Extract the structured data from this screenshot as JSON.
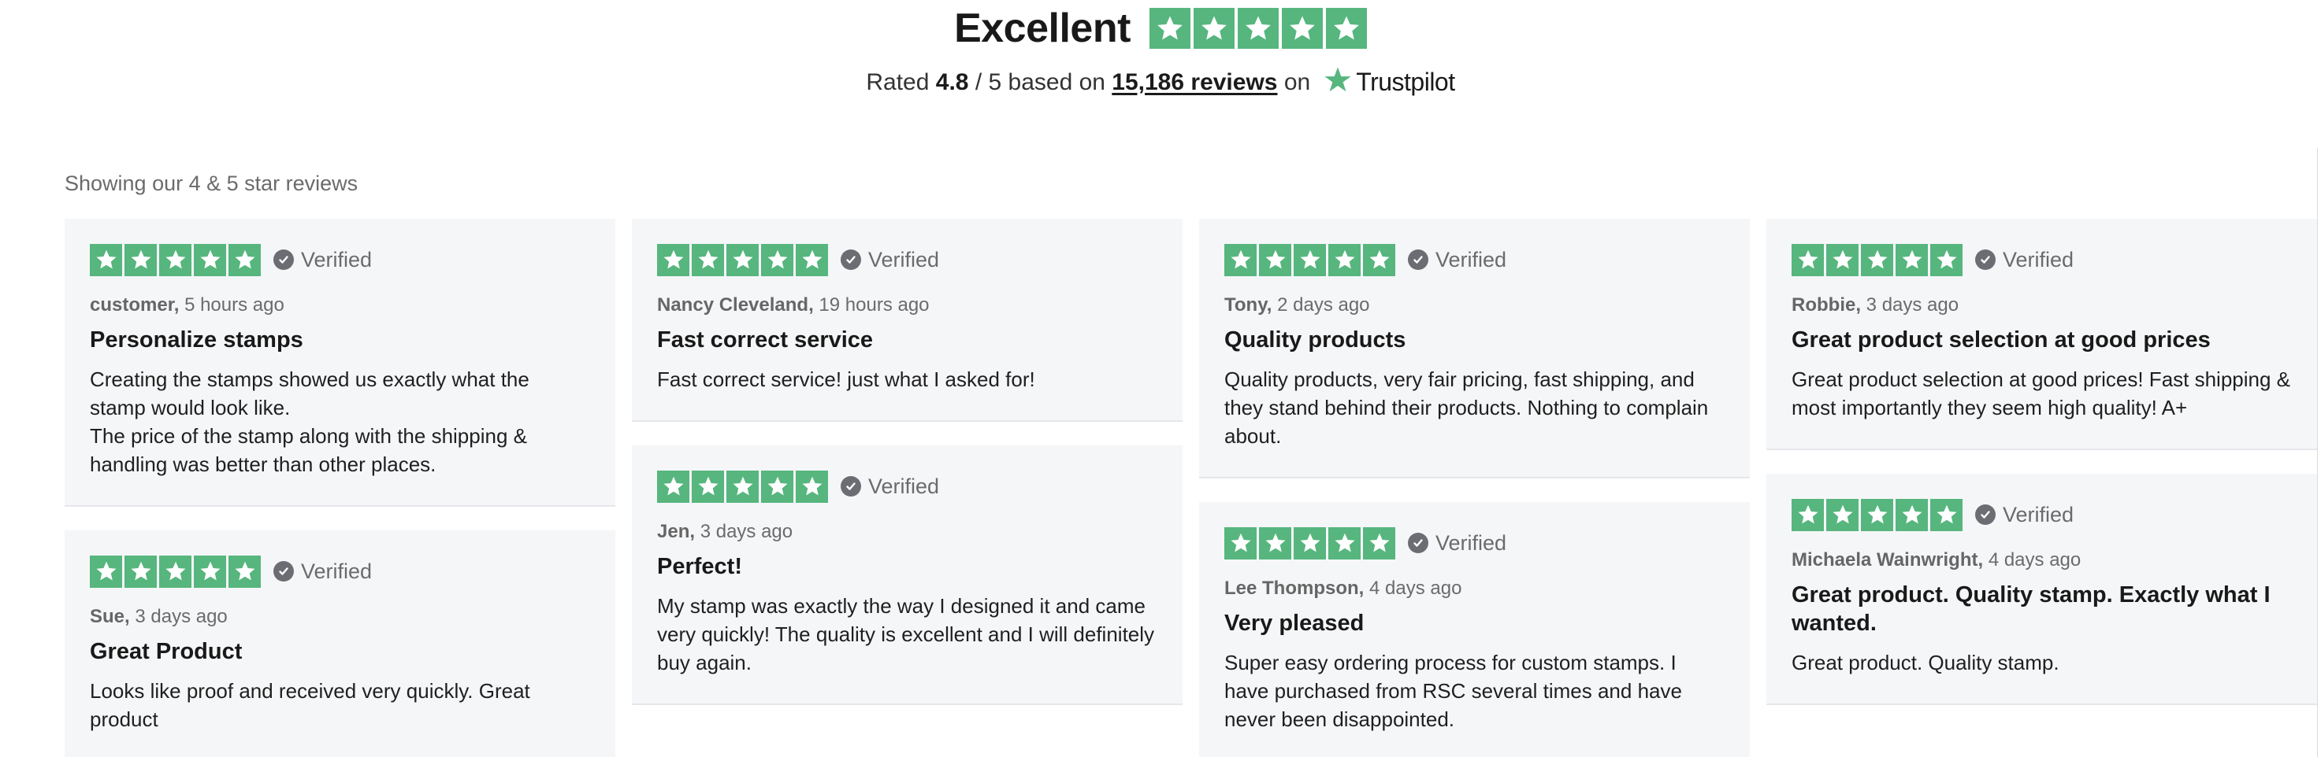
{
  "header": {
    "score_word": "Excellent",
    "rated_prefix": "Rated ",
    "rating": "4.8",
    "rating_suffix": " / 5 based on ",
    "reviews_count": "15,186 reviews",
    "on_text": " on",
    "brand": "Trustpilot",
    "star_color": "#56b67e"
  },
  "showing_text": "Showing our 4 & 5 star reviews",
  "verified_label": "Verified",
  "columns": [
    {
      "reviews": [
        {
          "author": "customer,",
          "time": "5 hours ago",
          "title": "Personalize stamps",
          "body": [
            "Creating the stamps showed us exactly what the stamp would look like.",
            "The price of the stamp along with the shipping & handling was better than other places."
          ]
        },
        {
          "author": "Sue,",
          "time": "3 days ago",
          "title": "Great Product",
          "body": [
            "Looks like proof and received very quickly. Great product"
          ]
        }
      ]
    },
    {
      "reviews": [
        {
          "author": "Nancy Cleveland,",
          "time": "19 hours ago",
          "title": "Fast correct service",
          "body": [
            "Fast correct service! just what I asked for!"
          ]
        },
        {
          "author": "Jen,",
          "time": "3 days ago",
          "title": "Perfect!",
          "body": [
            "My stamp was exactly the way I designed it and came very quickly! The quality is excellent and I will definitely buy again."
          ]
        }
      ]
    },
    {
      "reviews": [
        {
          "author": "Tony,",
          "time": "2 days ago",
          "title": "Quality products",
          "body": [
            "Quality products, very fair pricing, fast shipping, and they stand behind their products. Nothing to complain about."
          ]
        },
        {
          "author": "Lee Thompson,",
          "time": "4 days ago",
          "title": "Very pleased",
          "body": [
            "Super easy ordering process for custom stamps. I have purchased from RSC several times and have never been disappointed."
          ]
        }
      ]
    },
    {
      "reviews": [
        {
          "author": "Robbie,",
          "time": "3 days ago",
          "title": "Great product selection at good prices",
          "body": [
            "Great product selection at good prices! Fast shipping & most importantly they seem high quality! A+"
          ]
        },
        {
          "author": "Michaela Wainwright,",
          "time": "4 days ago",
          "title": "Great product. Quality stamp. Exactly what I wanted.",
          "body": [
            "Great product. Quality stamp."
          ]
        }
      ]
    }
  ]
}
